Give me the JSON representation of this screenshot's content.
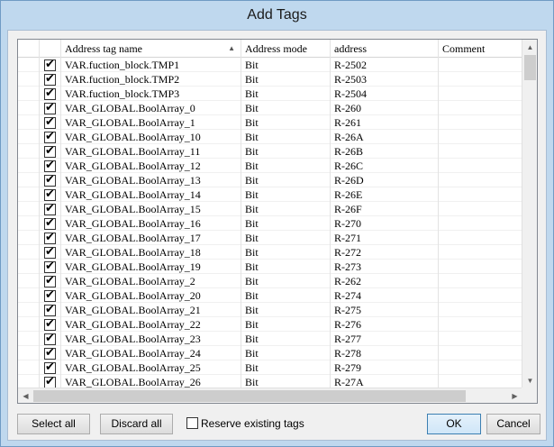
{
  "window": {
    "title": "Add Tags"
  },
  "grid": {
    "columns": {
      "name": "Address tag name",
      "mode": "Address mode",
      "address": "address",
      "comment": "Comment"
    },
    "rows": [
      {
        "checked": true,
        "name": "VAR.fuction_block.TMP1",
        "mode": "Bit",
        "address": "R-2502",
        "comment": ""
      },
      {
        "checked": true,
        "name": "VAR.fuction_block.TMP2",
        "mode": "Bit",
        "address": "R-2503",
        "comment": ""
      },
      {
        "checked": true,
        "name": "VAR.fuction_block.TMP3",
        "mode": "Bit",
        "address": "R-2504",
        "comment": ""
      },
      {
        "checked": true,
        "name": "VAR_GLOBAL.BoolArray_0",
        "mode": "Bit",
        "address": "R-260",
        "comment": ""
      },
      {
        "checked": true,
        "name": "VAR_GLOBAL.BoolArray_1",
        "mode": "Bit",
        "address": "R-261",
        "comment": ""
      },
      {
        "checked": true,
        "name": "VAR_GLOBAL.BoolArray_10",
        "mode": "Bit",
        "address": "R-26A",
        "comment": ""
      },
      {
        "checked": true,
        "name": "VAR_GLOBAL.BoolArray_11",
        "mode": "Bit",
        "address": "R-26B",
        "comment": ""
      },
      {
        "checked": true,
        "name": "VAR_GLOBAL.BoolArray_12",
        "mode": "Bit",
        "address": "R-26C",
        "comment": ""
      },
      {
        "checked": true,
        "name": "VAR_GLOBAL.BoolArray_13",
        "mode": "Bit",
        "address": "R-26D",
        "comment": ""
      },
      {
        "checked": true,
        "name": "VAR_GLOBAL.BoolArray_14",
        "mode": "Bit",
        "address": "R-26E",
        "comment": ""
      },
      {
        "checked": true,
        "name": "VAR_GLOBAL.BoolArray_15",
        "mode": "Bit",
        "address": "R-26F",
        "comment": ""
      },
      {
        "checked": true,
        "name": "VAR_GLOBAL.BoolArray_16",
        "mode": "Bit",
        "address": "R-270",
        "comment": ""
      },
      {
        "checked": true,
        "name": "VAR_GLOBAL.BoolArray_17",
        "mode": "Bit",
        "address": "R-271",
        "comment": ""
      },
      {
        "checked": true,
        "name": "VAR_GLOBAL.BoolArray_18",
        "mode": "Bit",
        "address": "R-272",
        "comment": ""
      },
      {
        "checked": true,
        "name": "VAR_GLOBAL.BoolArray_19",
        "mode": "Bit",
        "address": "R-273",
        "comment": ""
      },
      {
        "checked": true,
        "name": "VAR_GLOBAL.BoolArray_2",
        "mode": "Bit",
        "address": "R-262",
        "comment": ""
      },
      {
        "checked": true,
        "name": "VAR_GLOBAL.BoolArray_20",
        "mode": "Bit",
        "address": "R-274",
        "comment": ""
      },
      {
        "checked": true,
        "name": "VAR_GLOBAL.BoolArray_21",
        "mode": "Bit",
        "address": "R-275",
        "comment": ""
      },
      {
        "checked": true,
        "name": "VAR_GLOBAL.BoolArray_22",
        "mode": "Bit",
        "address": "R-276",
        "comment": ""
      },
      {
        "checked": true,
        "name": "VAR_GLOBAL.BoolArray_23",
        "mode": "Bit",
        "address": "R-277",
        "comment": ""
      },
      {
        "checked": true,
        "name": "VAR_GLOBAL.BoolArray_24",
        "mode": "Bit",
        "address": "R-278",
        "comment": ""
      },
      {
        "checked": true,
        "name": "VAR_GLOBAL.BoolArray_25",
        "mode": "Bit",
        "address": "R-279",
        "comment": ""
      },
      {
        "checked": true,
        "name": "VAR_GLOBAL.BoolArray_26",
        "mode": "Bit",
        "address": "R-27A",
        "comment": ""
      }
    ]
  },
  "buttons": {
    "select_all": "Select all",
    "discard_all": "Discard all",
    "reserve_existing": "Reserve existing tags",
    "ok": "OK",
    "cancel": "Cancel"
  },
  "icons": {
    "sort": "sort-up-icon",
    "check": "checkmark-icon",
    "scroll_up": "triangle-up-icon",
    "scroll_down": "triangle-down-icon",
    "scroll_left": "triangle-left-icon",
    "scroll_right": "triangle-right-icon"
  }
}
